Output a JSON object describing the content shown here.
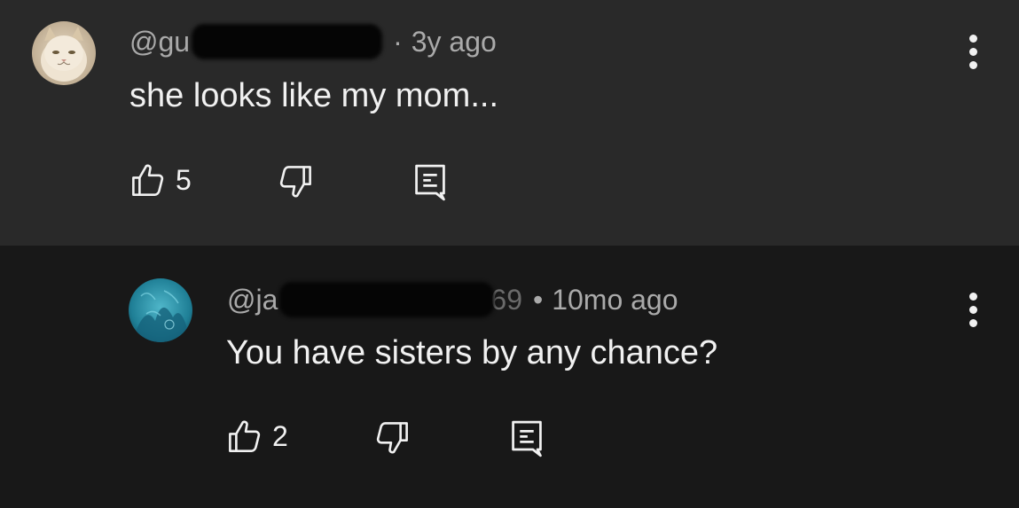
{
  "comments": [
    {
      "handle_prefix": "@gu",
      "handle_suffix": "",
      "time": "3y ago",
      "separator": "·",
      "text": "she looks like my mom...",
      "likes": "5",
      "avatar": "cat-avatar-icon"
    },
    {
      "handle_prefix": "@ja",
      "handle_suffix": "69",
      "time": "10mo ago",
      "separator": "•",
      "text": "You have sisters by any chance?",
      "likes": "2",
      "avatar": "teal-avatar-icon"
    }
  ],
  "icons": {
    "like": "thumbs-up-icon",
    "dislike": "thumbs-down-icon",
    "reply": "reply-icon",
    "more": "more-vertical-icon"
  },
  "colors": {
    "top_background": "#292929",
    "bottom_background": "#181818",
    "meta_text": "#aaaaaa",
    "text": "#f1f1f1"
  }
}
